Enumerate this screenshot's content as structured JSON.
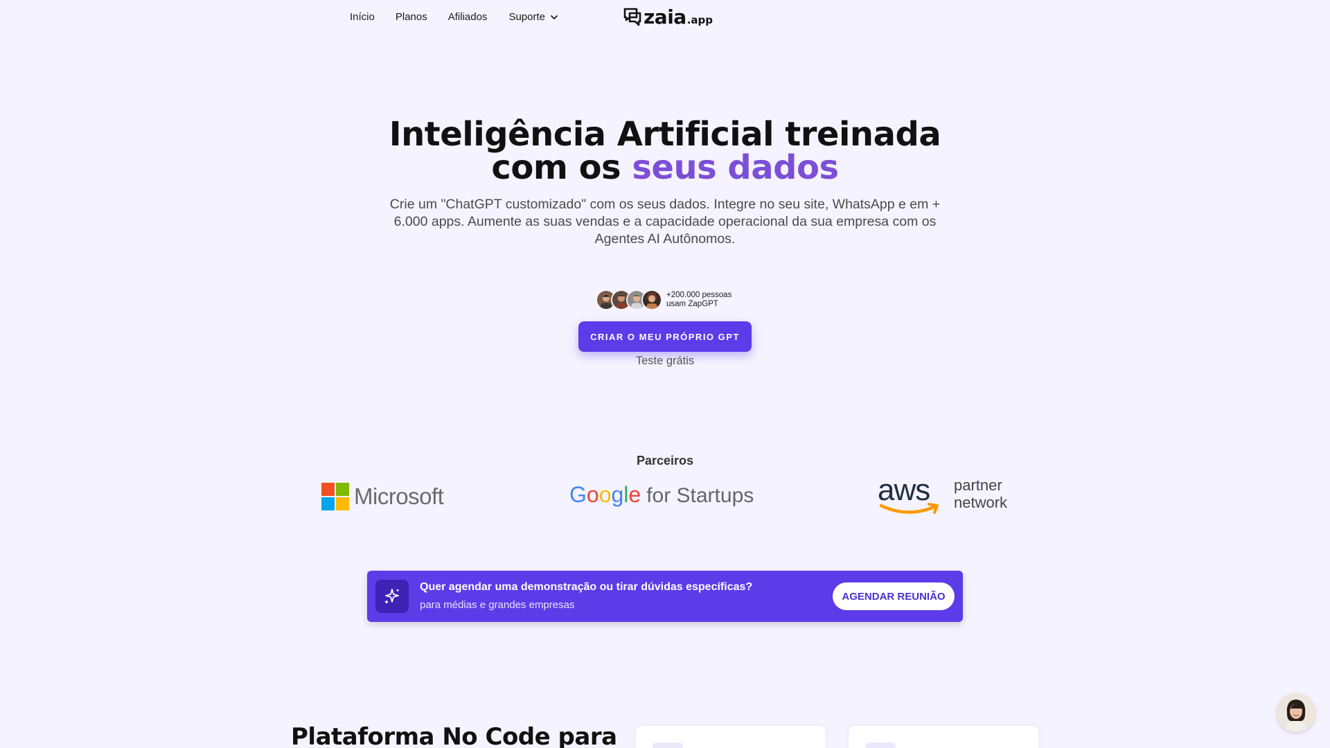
{
  "nav": {
    "items": [
      {
        "label": "Início"
      },
      {
        "label": "Planos"
      },
      {
        "label": "Afiliados"
      },
      {
        "label": "Suporte"
      }
    ],
    "logo": {
      "text": "zaia",
      "suffix": ".app"
    }
  },
  "hero": {
    "title_line1": "Inteligência Artificial treinada",
    "title_line2_plain": "com os ",
    "title_line2_accent": "seus dados",
    "subtitle": "Crie um \"ChatGPT customizado\" com os seus dados. Integre no seu site, WhatsApp e em + 6.000 apps. Aumente as suas vendas e a capacidade operacional da sua empresa com os Agentes AI Autônomos.",
    "social_line1": "+200.000 pessoas",
    "social_line2": "usam ZapGPT",
    "cta_label": "CRIAR O MEU PRÓPRIO GPT",
    "cta_sub": "Teste grátis"
  },
  "partners": {
    "label": "Parceiros",
    "items": [
      {
        "name": "Microsoft"
      },
      {
        "name": "Google",
        "rest": "for Startups"
      },
      {
        "name": "aws",
        "line1": "partner",
        "line2": "network"
      }
    ]
  },
  "banner": {
    "title": "Quer agendar uma demonstração ou tirar dúvidas específicas?",
    "subtitle": "para médias e grandes empresas",
    "button": "AGENDAR REUNIÃO"
  },
  "section": {
    "title": "Plataforma No Code para"
  },
  "colors": {
    "background": "#f5f3ff",
    "primary": "#5b3ce8",
    "accent_text": "#7c4fd6"
  }
}
